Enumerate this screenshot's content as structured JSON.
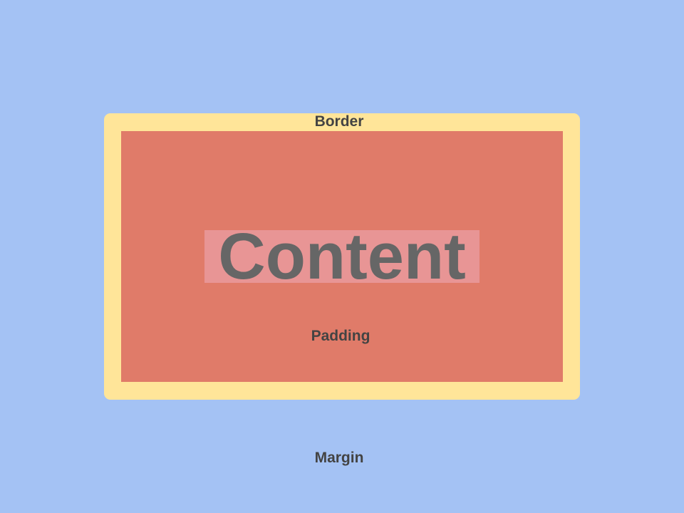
{
  "diagram": {
    "labels": {
      "border": "Border",
      "content": "Content",
      "padding": "Padding",
      "margin": "Margin"
    },
    "colors": {
      "margin": "#a4c2f4",
      "border": "#ffe599",
      "padding": "#e07b69",
      "content": "#e89595",
      "text": "#434343",
      "content_text": "#666666"
    }
  }
}
